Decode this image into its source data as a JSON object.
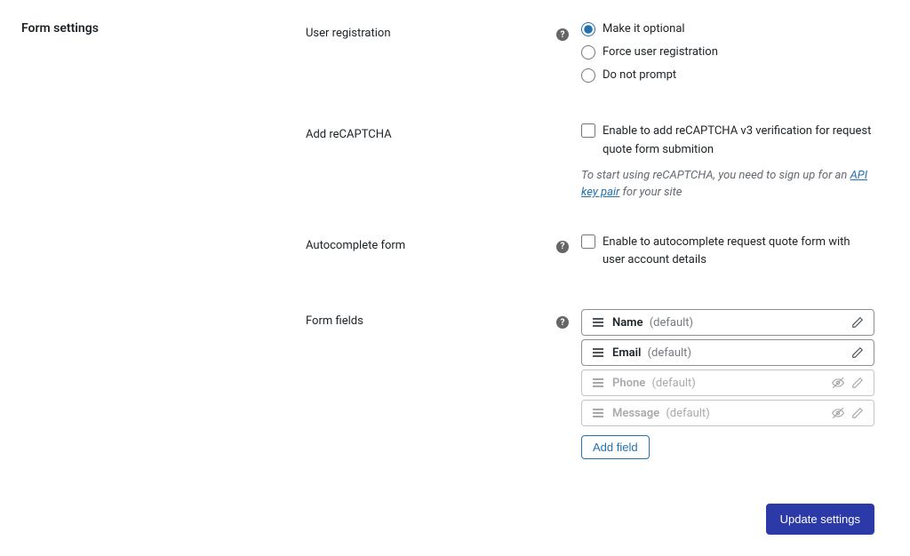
{
  "section_title": "Form settings",
  "user_registration": {
    "label": "User registration",
    "options": {
      "optional": "Make it optional",
      "force": "Force user registration",
      "no_prompt": "Do not prompt"
    }
  },
  "recaptcha": {
    "label": "Add reCAPTCHA",
    "checkbox_label": "Enable to add reCAPTCHA v3 verification for request quote form submition",
    "help_before": "To start using reCAPTCHA, you need to sign up for an ",
    "help_link": "API key pair",
    "help_after": " for your site"
  },
  "autocomplete": {
    "label": "Autocomplete form",
    "checkbox_label": "Enable to autocomplete request quote form with user account details"
  },
  "form_fields": {
    "label": "Form fields",
    "default_suffix": "(default)",
    "items": [
      {
        "name": "Name",
        "enabled": true
      },
      {
        "name": "Email",
        "enabled": true
      },
      {
        "name": "Phone",
        "enabled": false
      },
      {
        "name": "Message",
        "enabled": false
      }
    ],
    "add_field_label": "Add field"
  },
  "footer": {
    "update_label": "Update settings"
  }
}
